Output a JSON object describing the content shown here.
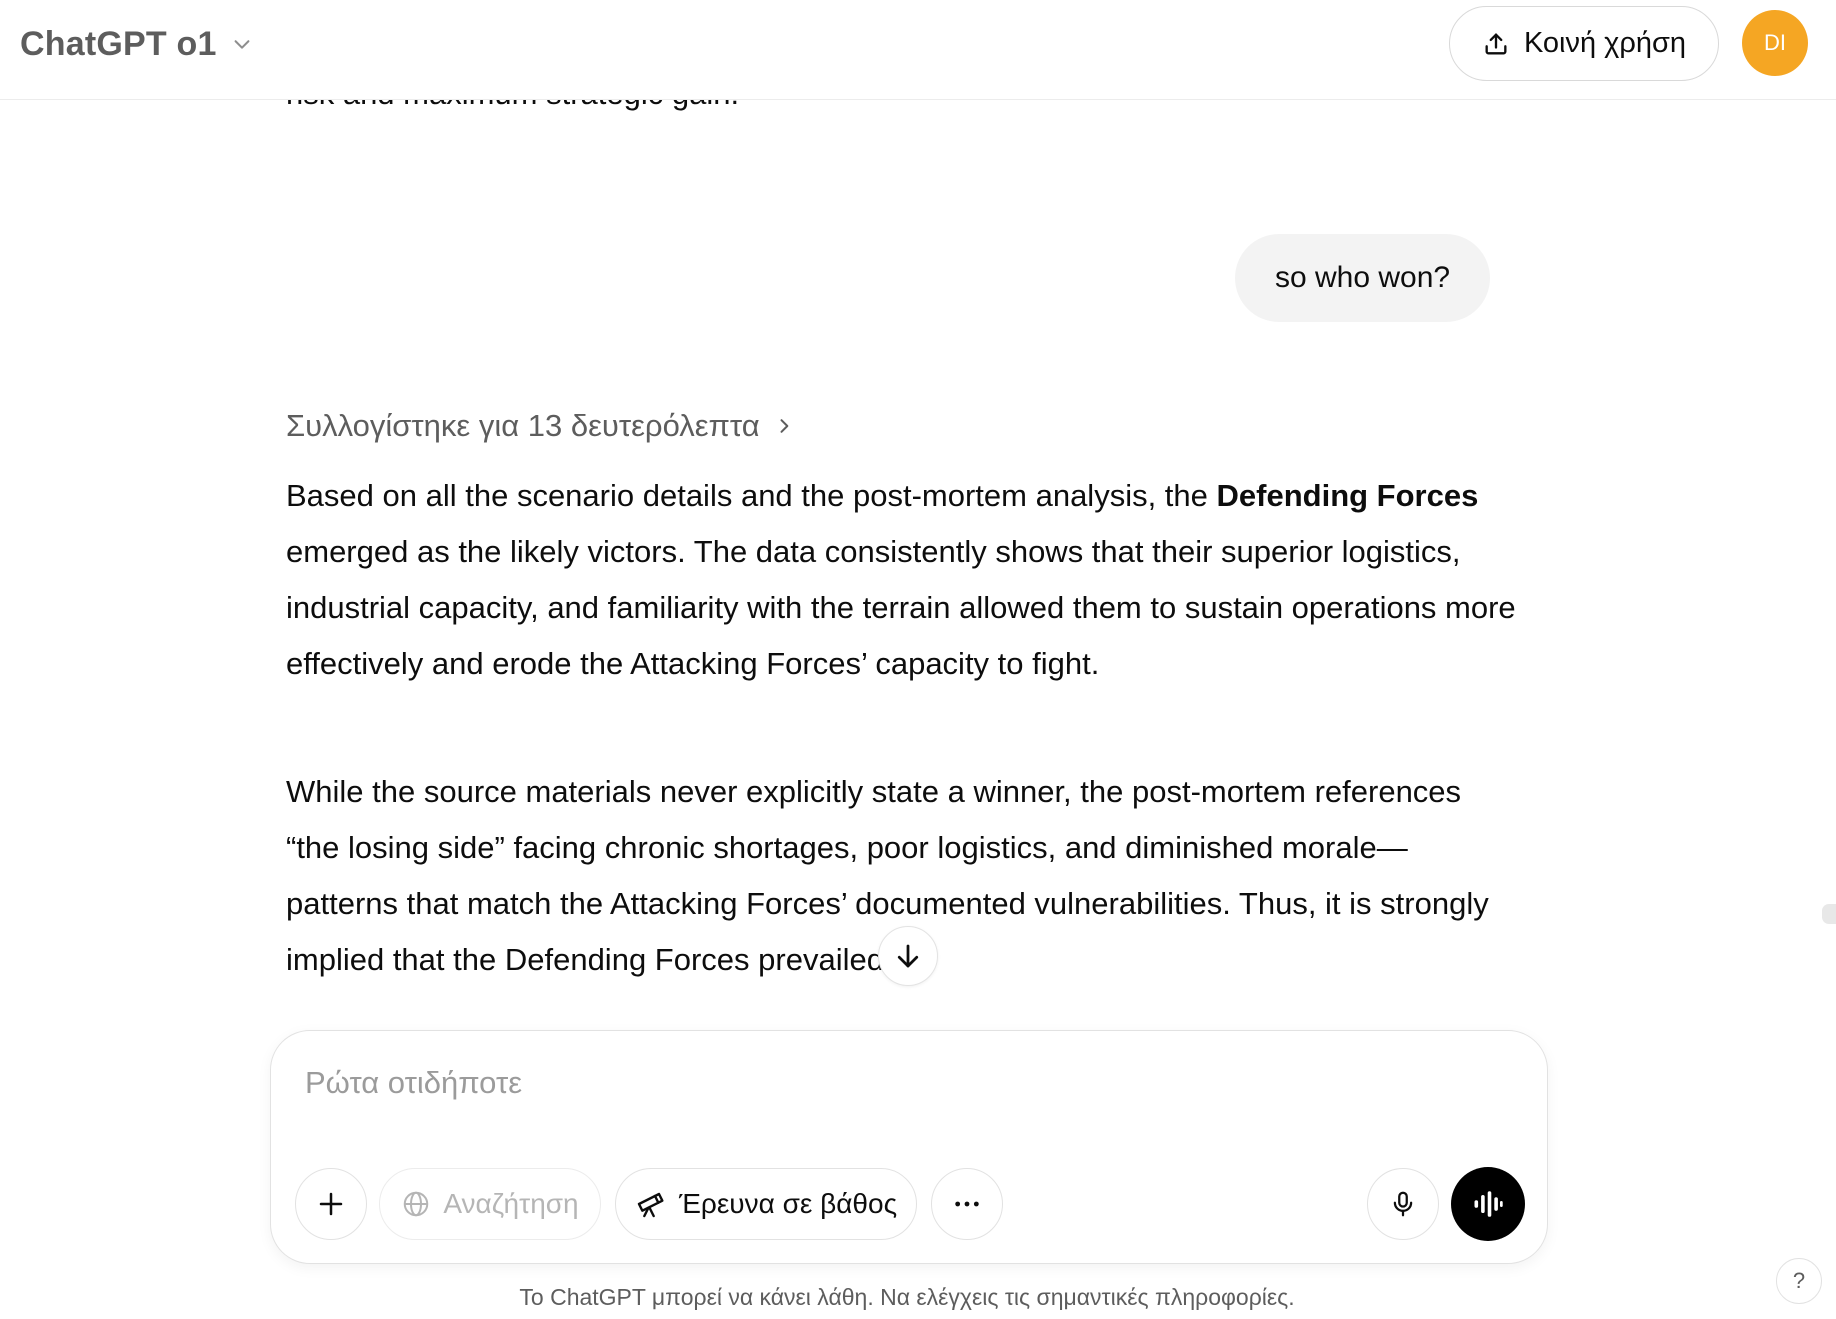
{
  "header": {
    "model_name": "ChatGPT o1",
    "share_label": "Κοινή χρήση",
    "avatar_initials": "DI"
  },
  "conversation": {
    "previous_fragment": "risk and maximum strategic gain.",
    "user_message": "so who won?",
    "reasoning_label": "Συλλογίστηκε για 13 δευτερόλεπτα",
    "answer_p1_before_bold": "Based on all the scenario details and the post-mortem analysis, the ",
    "answer_p1_bold": "Defending Forces",
    "answer_p1_after_bold": " emerged as the likely victors. The data consistently shows that their superior logistics, industrial capacity, and familiarity with the terrain allowed them to sustain operations more effectively and erode the Attacking Forces’ capacity to fight.",
    "answer_p2": "While the source materials never explicitly state a winner, the post-mortem references “the losing side” facing chronic shortages, poor logistics, and diminished morale—patterns that match the Attacking Forces’ documented vulnerabilities. Thus, it is strongly implied that the Defending Forces prevailed."
  },
  "composer": {
    "placeholder": "Ρώτα οτιδήποτε",
    "search_label": "Αναζήτηση",
    "deep_research_label": "Έρευνα σε βάθος"
  },
  "footer": {
    "disclaimer": "Το ChatGPT μπορεί να κάνει λάθη. Να ελέγχεις τις σημαντικές πληροφορίες.",
    "help_label": "?"
  },
  "colors": {
    "avatar_bg": "#f5a623",
    "voice_button_bg": "#000000",
    "user_bubble_bg": "#f3f3f3"
  }
}
